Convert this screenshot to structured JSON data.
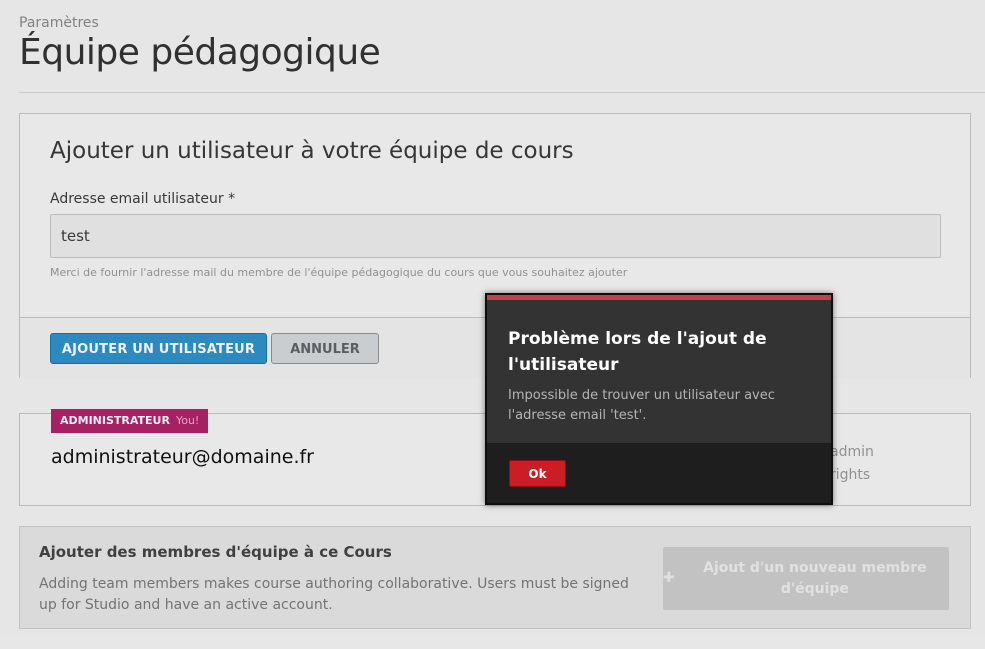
{
  "header": {
    "breadcrumb": "Paramètres",
    "title": "Équipe pédagogique"
  },
  "add_user_form": {
    "title": "Ajouter un utilisateur à votre équipe de cours",
    "email_label": "Adresse email utilisateur *",
    "email_value": "test",
    "email_help": "Merci de fournir l'adresse mail du membre de l'équipe pédagogique du cours que vous souhaitez ajouter",
    "add_button": "AJOUTER UN UTILISATEUR",
    "cancel_button": "ANNULER"
  },
  "member": {
    "role": "ADMINISTRATEUR",
    "you_label": "You!",
    "email": "administrateur@domaine.fr",
    "note_line1": "admin",
    "note_line2": "rights"
  },
  "team_info": {
    "title": "Ajouter des membres d'équipe à ce Cours",
    "text": "Adding team members makes course authoring collaborative. Users must be signed up for Studio and have an active account.",
    "new_member_button": "Ajout d'un nouveau membre d'équipe"
  },
  "modal": {
    "title": "Problème lors de l'ajout de l'utilisateur",
    "message": "Impossible de trouver un utilisateur avec l'adresse email 'test'.",
    "ok_button": "Ok"
  },
  "colors": {
    "primary_button": "#2f93cd",
    "role_badge": "#b0246b",
    "modal_accent": "#c1404c",
    "ok_button": "#cb1d26"
  },
  "icons": {
    "new_member": "plus-icon"
  }
}
